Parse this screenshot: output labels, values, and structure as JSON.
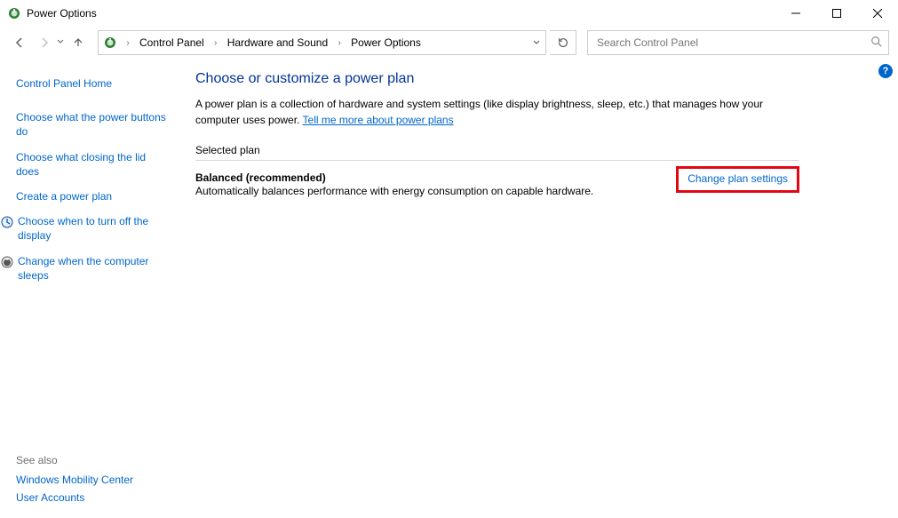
{
  "window": {
    "title": "Power Options"
  },
  "breadcrumb": {
    "items": [
      "Control Panel",
      "Hardware and Sound",
      "Power Options"
    ]
  },
  "search": {
    "placeholder": "Search Control Panel"
  },
  "sidebar": {
    "home": "Control Panel Home",
    "links": [
      "Choose what the power buttons do",
      "Choose what closing the lid does",
      "Create a power plan",
      "Choose when to turn off the display",
      "Change when the computer sleeps"
    ],
    "see_also_label": "See also",
    "see_also": [
      "Windows Mobility Center",
      "User Accounts"
    ]
  },
  "main": {
    "heading": "Choose or customize a power plan",
    "description": "A power plan is a collection of hardware and system settings (like display brightness, sleep, etc.) that manages how your computer uses power. ",
    "desc_link": "Tell me more about power plans",
    "section": "Selected plan",
    "plan": {
      "name": "Balanced (recommended)",
      "sub": "Automatically balances performance with energy consumption on capable hardware.",
      "change": "Change plan settings"
    }
  }
}
